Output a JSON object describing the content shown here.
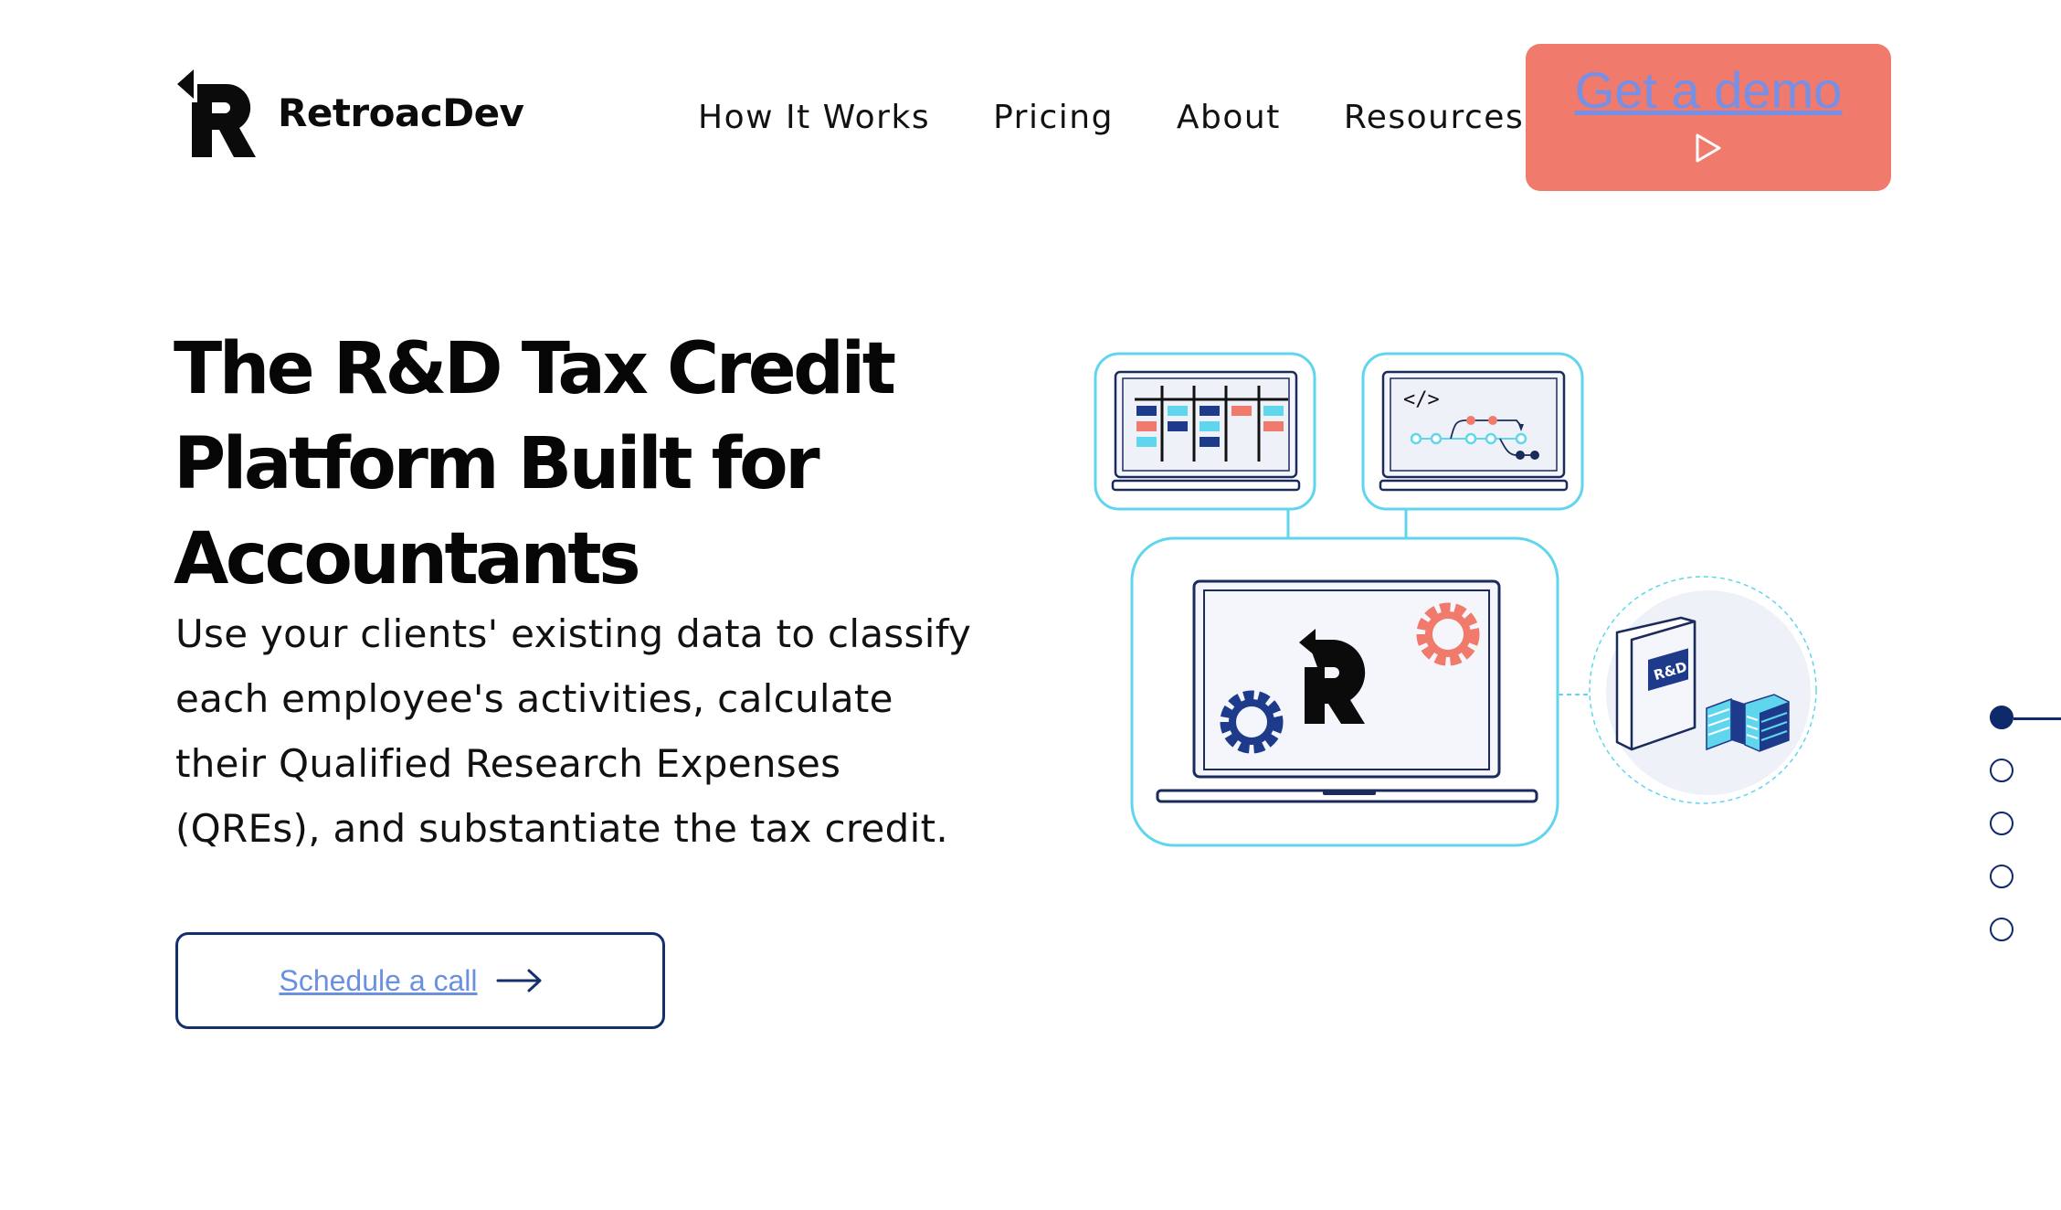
{
  "brand": {
    "name": "RetroacDev",
    "logo_icon": "retroac-r-arrow-icon"
  },
  "nav": {
    "items": [
      {
        "label": "How It Works"
      },
      {
        "label": "Pricing"
      },
      {
        "label": "About"
      },
      {
        "label": "Resources"
      }
    ]
  },
  "cta": {
    "demo_label": "Get a demo",
    "demo_icon": "play-icon",
    "call_label": "Schedule a call",
    "call_icon": "arrow-right-icon"
  },
  "hero": {
    "title": "The R&D Tax Credit Platform Built for Accountants",
    "description": "Use your clients' existing data to classify each employee's activities, calculate their Qualified Research Expenses (QREs), and substantiate the tax credit."
  },
  "illustration": {
    "code_tag": "</>",
    "book_label": "R&D",
    "icons": [
      "kanban-board-icon",
      "code-branch-icon",
      "laptop-icon",
      "gear-icon",
      "book-icon",
      "money-stack-icon"
    ]
  },
  "pagination": {
    "count": 5,
    "active_index": 0
  },
  "colors": {
    "accent_coral": "#f07a6b",
    "navy": "#14306c",
    "cyan": "#5fd6ee",
    "link_blue": "#6b90e0"
  }
}
